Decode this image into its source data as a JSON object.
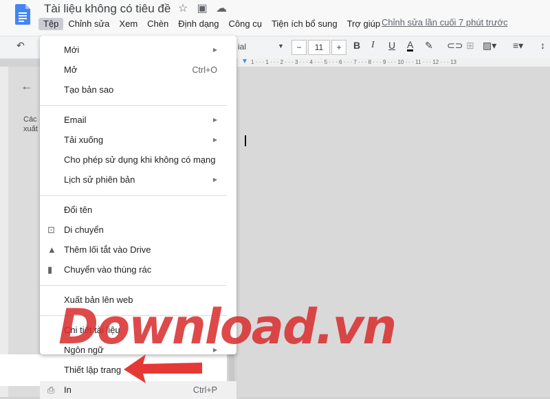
{
  "app": {
    "title": "Tài liệu không có tiêu đề",
    "last_edit": "Chỉnh sửa lần cuối 7 phút trước"
  },
  "menubar": [
    "Tệp",
    "Chỉnh sửa",
    "Xem",
    "Chèn",
    "Định dạng",
    "Công cụ",
    "Tiện ích bổ sung",
    "Trợ giúp"
  ],
  "toolbar": {
    "font_partial": "ial",
    "font_size": "11",
    "minus": "−",
    "plus": "+"
  },
  "ruler": "1 · · · 1 · · · 2 · · · 3 · · · 4 · · · 5 · · · 6 · · · 7 · · · 8 · · · 9 · · · 10 · · · 11 · · · 12 · · · 13",
  "side_panel": {
    "text1": "Các",
    "text2": "xuất"
  },
  "file_menu": {
    "new": "Mới",
    "open": "Mở",
    "open_shortcut": "Ctrl+O",
    "copy": "Tạo bản sao",
    "email": "Email",
    "download": "Tải xuống",
    "offline": "Cho phép sử dụng khi không có mạng",
    "version_history": "Lịch sử phiên bản",
    "rename": "Đổi tên",
    "move": "Di chuyển",
    "add_shortcut": "Thêm lối tắt vào Drive",
    "trash": "Chuyển vào thùng rác",
    "publish": "Xuất bản lên web",
    "details": "Chi tiết tài liệu",
    "language": "Ngôn ngữ",
    "page_setup": "Thiết lập trang",
    "print": "In",
    "print_shortcut": "Ctrl+P"
  },
  "watermark": "Download.vn",
  "colors": {
    "accent_red": "#e53935",
    "menu_active": "#c9cdd3",
    "doc_blue": "#4285f4"
  }
}
